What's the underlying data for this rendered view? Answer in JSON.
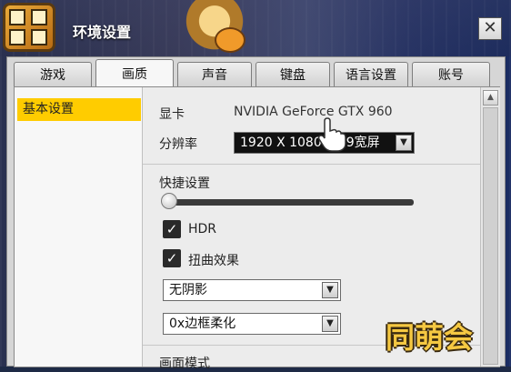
{
  "window": {
    "title": "环境设置",
    "close_label": "✕"
  },
  "tabs": [
    {
      "label": "游戏",
      "active": false
    },
    {
      "label": "画质",
      "active": true
    },
    {
      "label": "声音",
      "active": false
    },
    {
      "label": "键盘",
      "active": false
    },
    {
      "label": "语言设置",
      "active": false
    },
    {
      "label": "账号",
      "active": false
    }
  ],
  "sidebar": {
    "items": [
      {
        "label": "基本设置",
        "selected": true
      }
    ]
  },
  "graphics": {
    "gpu_label": "显卡",
    "gpu_value": "NVIDIA GeForce GTX 960",
    "resolution_label": "分辨率",
    "resolution_value": "1920 X 1080 16:9宽屏",
    "quick_settings_label": "快捷设置",
    "quick_slider_level": 0,
    "hdr_label": "HDR",
    "hdr_checked": true,
    "distortion_label": "扭曲效果",
    "distortion_checked": true,
    "shadow_value": "无阴影",
    "antialias_value": "0x边框柔化",
    "next_section_label": "画面模式"
  },
  "icons": {
    "close": "close-icon",
    "dropdown": "chevron-down-icon",
    "scroll_up": "arrow-up-icon",
    "check": "checkmark-icon",
    "cursor": "hand-pointer-icon"
  },
  "watermarks": {
    "site_logo": "同萌会"
  },
  "colors": {
    "selected": "#ffcc00",
    "panel": "#ececec",
    "select_bg": "#111111"
  }
}
